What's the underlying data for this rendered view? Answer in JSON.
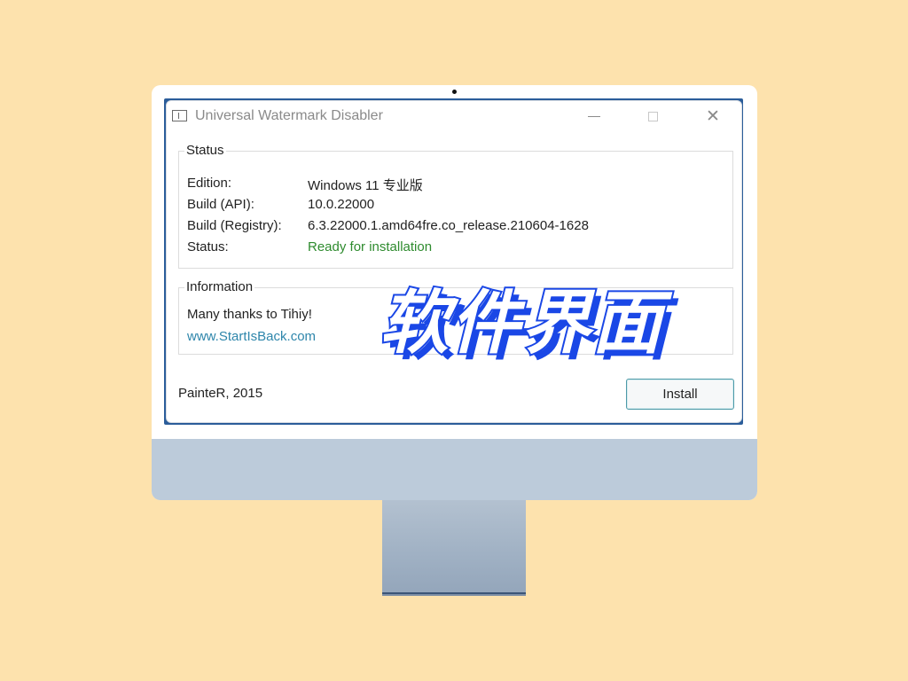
{
  "window": {
    "title": "Universal Watermark Disabler",
    "controls": {
      "minimize": "minimize-icon",
      "maximize": "maximize-icon",
      "close": "✕"
    }
  },
  "status_group": {
    "legend": "Status",
    "rows": [
      {
        "label": "Edition:",
        "value": "Windows 11 专业版"
      },
      {
        "label": "Build (API):",
        "value": "10.0.22000"
      },
      {
        "label": "Build (Registry):",
        "value": "6.3.22000.1.amd64fre.co_release.210604-1628"
      },
      {
        "label": "Status:",
        "value": "Ready for installation"
      }
    ]
  },
  "info_group": {
    "legend": "Information",
    "thanks": "Many thanks to Tihiy!",
    "link": "www.StartIsBack.com"
  },
  "footer": {
    "author": "PainteR, 2015",
    "install_label": "Install"
  },
  "overlay": {
    "caption": "软件界面"
  },
  "colors": {
    "background": "#fde2ad",
    "status_ok": "#2e8b2e",
    "link": "#2e86ab",
    "overlay_stroke": "#1a47e6"
  }
}
